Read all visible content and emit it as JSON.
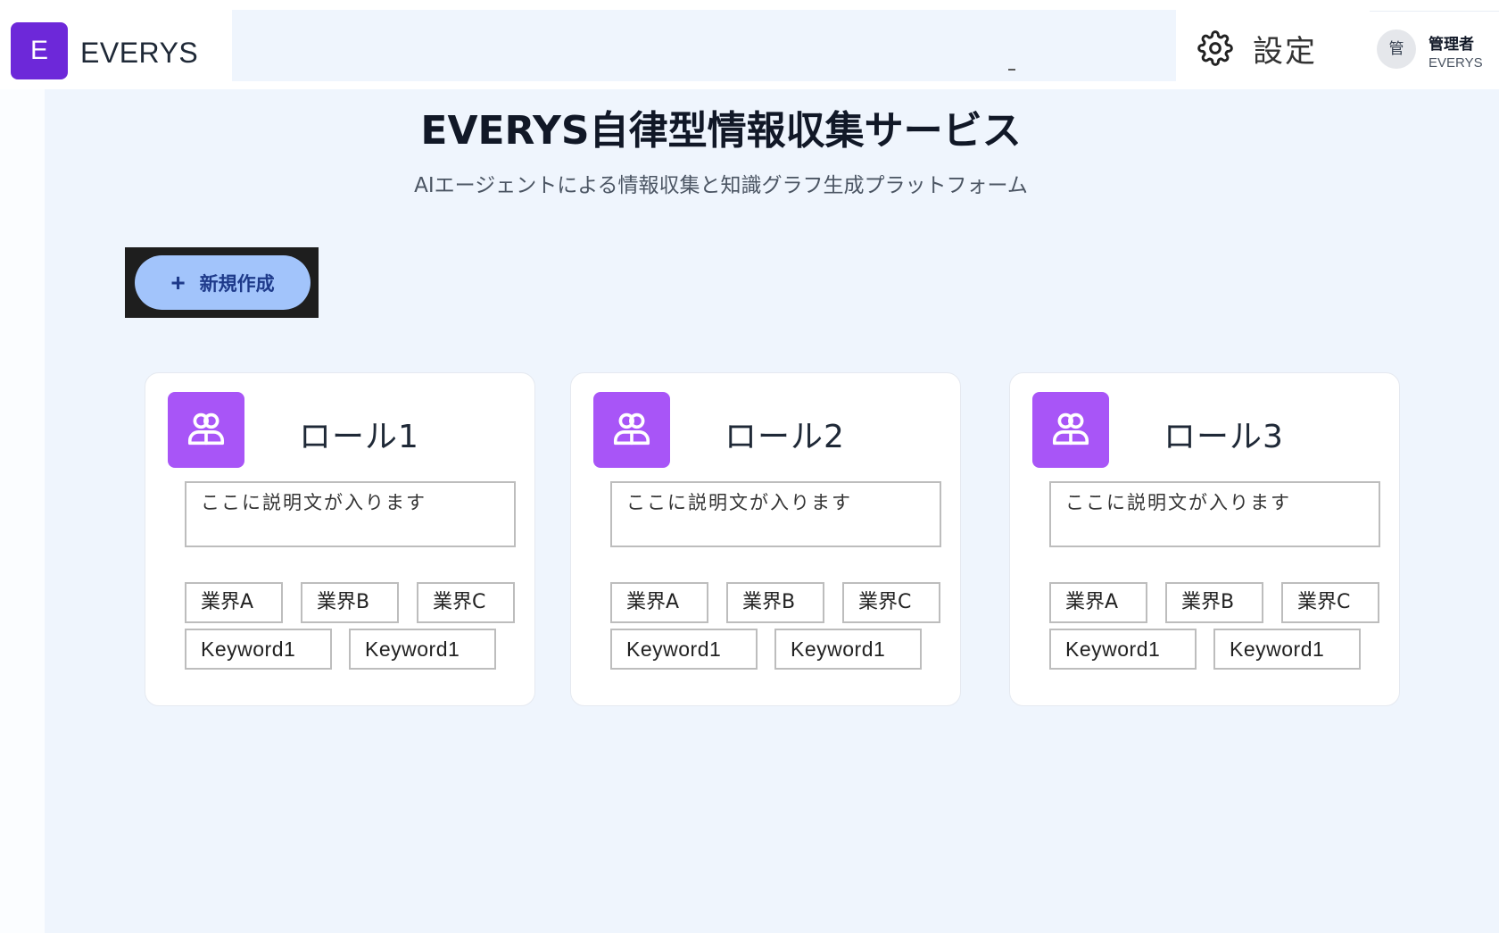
{
  "header": {
    "logo_letter": "E",
    "brand_name": "EVERYS",
    "settings_label": "設定",
    "user": {
      "avatar_text": "管",
      "name": "管理者",
      "org": "EVERYS"
    }
  },
  "hero": {
    "title": "EVERYS自律型情報収集サービス",
    "subtitle": "AIエージェントによる情報収集と知識グラフ生成プラットフォーム"
  },
  "actions": {
    "new_label": "新規作成"
  },
  "roles": [
    {
      "title": "ロール1",
      "description": "ここに説明文が入ります",
      "industries": [
        "業界A",
        "業界B",
        "業界C"
      ],
      "keywords": [
        "Keyword1",
        "Keyword1"
      ]
    },
    {
      "title": "ロール2",
      "description": "ここに説明文が入ります",
      "industries": [
        "業界A",
        "業界B",
        "業界C"
      ],
      "keywords": [
        "Keyword1",
        "Keyword1"
      ]
    },
    {
      "title": "ロール3",
      "description": "ここに説明文が入ります",
      "industries": [
        "業界A",
        "業界B",
        "業界C"
      ],
      "keywords": [
        "Keyword1",
        "Keyword1"
      ]
    }
  ],
  "icons": {
    "settings": "gear-icon",
    "new": "plus-icon",
    "role": "users-icon"
  },
  "colors": {
    "brand": "#6d28d9",
    "role_icon": "#a855f7",
    "new_button": "#a2c4fb",
    "background": "#eff5fd"
  }
}
